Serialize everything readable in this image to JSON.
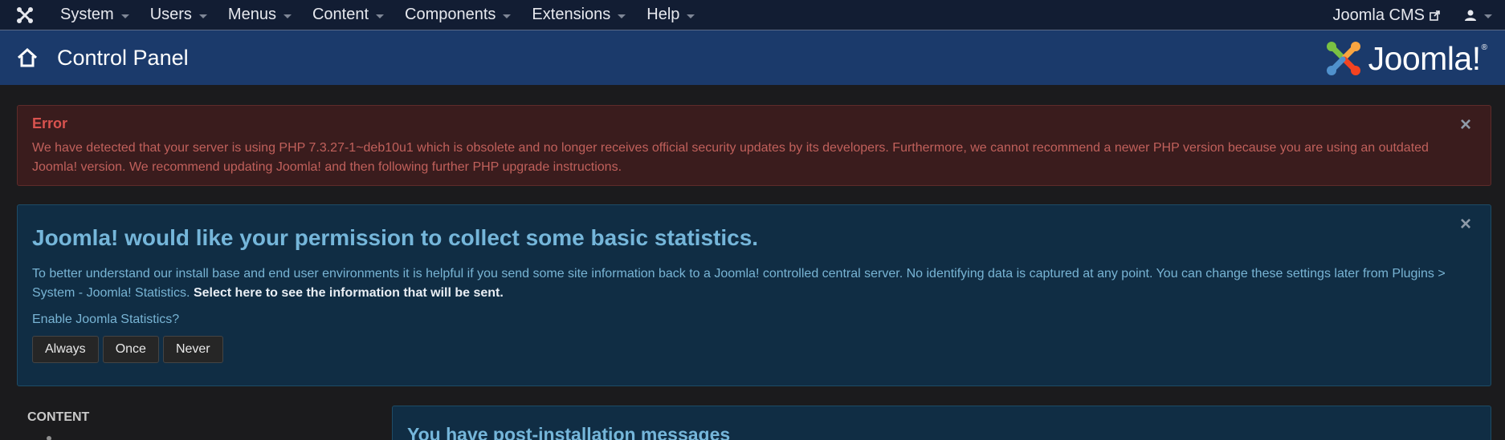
{
  "navbar": {
    "logo_icon": "joomla-icon",
    "menu": [
      {
        "label": "System"
      },
      {
        "label": "Users"
      },
      {
        "label": "Menus"
      },
      {
        "label": "Content"
      },
      {
        "label": "Components"
      },
      {
        "label": "Extensions"
      },
      {
        "label": "Help"
      }
    ],
    "site_link": "Joomla CMS",
    "site_link_icon": "external-link-icon",
    "user_icon": "user-icon"
  },
  "header": {
    "icon": "home-icon",
    "title": "Control Panel",
    "brand_text": "Joomla!",
    "brand_mark": "®"
  },
  "error_alert": {
    "heading": "Error",
    "message": "We have detected that your server is using PHP 7.3.27-1~deb10u1 which is obsolete and no longer receives official security updates by its developers. Furthermore, we cannot recommend a newer PHP version because you are using an outdated Joomla! version. We recommend updating Joomla! and then following further PHP upgrade instructions.",
    "close": "×"
  },
  "stats_alert": {
    "title": "Joomla! would like your permission to collect some basic statistics.",
    "message": "To better understand our install base and end user environments it is helpful if you send some site information back to a Joomla! controlled central server. No identifying data is captured at any point. You can change these settings later from Plugins > System - Joomla! Statistics.",
    "link": "Select here to see the information that will be sent.",
    "question": "Enable Joomla Statistics?",
    "buttons": {
      "always": "Always",
      "once": "Once",
      "never": "Never"
    },
    "close": "×"
  },
  "sidebar": {
    "heading": "CONTENT"
  },
  "messages_panel": {
    "title": "You have post-installation messages"
  },
  "colors": {
    "navbar_bg": "#121d33",
    "header_bg": "#1b3a6b",
    "error_bg": "#3a1c1d",
    "error_text": "#d9534f",
    "info_bg": "#102d44",
    "info_text": "#75b6da",
    "page_bg": "#1b1b1d"
  }
}
